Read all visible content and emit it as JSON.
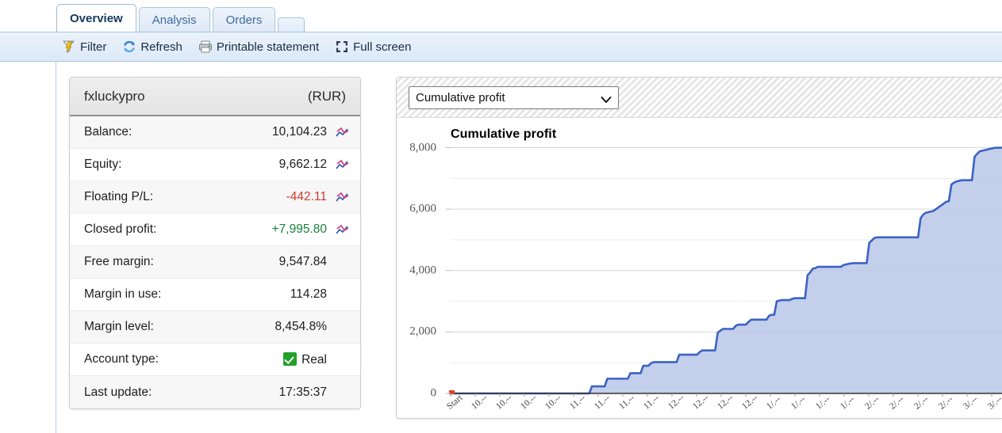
{
  "tabs": [
    {
      "label": "Overview",
      "active": true
    },
    {
      "label": "Analysis",
      "active": false
    },
    {
      "label": "Orders",
      "active": false
    },
    {
      "label": "",
      "active": false,
      "blank": true
    }
  ],
  "toolbar": {
    "items": [
      {
        "label": "Filter",
        "icon": "filter-icon"
      },
      {
        "label": "Refresh",
        "icon": "refresh-icon"
      },
      {
        "label": "Printable statement",
        "icon": "printer-icon"
      },
      {
        "label": "Full screen",
        "icon": "fullscreen-icon"
      }
    ]
  },
  "account": {
    "name": "fxluckypro",
    "currency": "(RUR)",
    "rows": [
      {
        "label": "Balance:",
        "value": "10,104.23",
        "tone": "",
        "spark": true
      },
      {
        "label": "Equity:",
        "value": "9,662.12",
        "tone": "",
        "spark": true
      },
      {
        "label": "Floating P/L:",
        "value": "-442.11",
        "tone": "neg",
        "spark": true
      },
      {
        "label": "Closed profit:",
        "value": "+7,995.80",
        "tone": "pos",
        "spark": true
      },
      {
        "label": "Free margin:",
        "value": "9,547.84",
        "tone": "",
        "spark": false
      },
      {
        "label": "Margin in use:",
        "value": "114.28",
        "tone": "",
        "spark": false
      },
      {
        "label": "Margin level:",
        "value": "8,454.8%",
        "tone": "",
        "spark": false
      },
      {
        "label": "Account type:",
        "value": "Real",
        "tone": "",
        "spark": false,
        "check": true
      },
      {
        "label": "Last update:",
        "value": "17:35:37",
        "tone": "",
        "spark": false
      }
    ]
  },
  "chart_panel": {
    "selected_option": "Cumulative profit",
    "options": [
      "Cumulative profit"
    ]
  },
  "colors": {
    "line": "#3b62c4",
    "fill": "#b8c7e8",
    "positive": "#188038",
    "negative": "#d13a2a",
    "accent": "#3c6ca0",
    "check_green": "#22a02a"
  },
  "chart_data": {
    "type": "area",
    "title": "Cumulative profit",
    "xlabel": "",
    "ylabel": "",
    "ylim": [
      0,
      8400
    ],
    "yticks": [
      0,
      2000,
      4000,
      6000,
      8000
    ],
    "ytick_labels": [
      "0",
      "2,000",
      "4,000",
      "6,000",
      "8,000"
    ],
    "minor_gridlines": [
      1000,
      3000,
      5000,
      7000
    ],
    "grid": true,
    "legend": false,
    "x_tick_labels": [
      "Start",
      "10.--",
      "10.--",
      "10.--",
      "10.--",
      "11.--",
      "11.--",
      "11.--",
      "11.--",
      "12.--",
      "12.--",
      "12.--",
      "12.--",
      "1/.--",
      "1/.--",
      "1/.--",
      "1/.--",
      "2/.--",
      "2/.--",
      "2/.--",
      "2/.--",
      "3/.--",
      "3/.--"
    ],
    "series": [
      {
        "name": "Cumulative profit",
        "values": [
          0,
          0,
          0,
          0,
          0,
          0,
          0,
          0,
          0,
          0,
          0,
          0,
          0,
          0,
          0,
          0,
          0,
          0,
          0,
          0,
          0,
          0,
          0,
          0,
          0,
          0,
          0,
          0,
          0,
          0,
          0,
          0,
          0,
          0,
          0,
          0,
          0,
          0,
          0,
          0,
          0,
          0,
          0,
          0,
          0,
          0,
          0,
          0,
          0,
          0,
          0,
          0,
          0,
          0,
          0,
          230,
          230,
          230,
          230,
          230,
          230,
          480,
          480,
          480,
          480,
          480,
          480,
          480,
          480,
          480,
          660,
          660,
          660,
          660,
          660,
          900,
          900,
          900,
          980,
          1020,
          1020,
          1020,
          1020,
          1020,
          1020,
          1020,
          1020,
          1020,
          1020,
          1260,
          1260,
          1260,
          1260,
          1260,
          1260,
          1260,
          1260,
          1350,
          1400,
          1400,
          1400,
          1400,
          1400,
          1400,
          1980,
          2040,
          2100,
          2100,
          2100,
          2100,
          2100,
          2200,
          2240,
          2240,
          2240,
          2240,
          2330,
          2400,
          2400,
          2400,
          2400,
          2400,
          2400,
          2400,
          2530,
          2560,
          2560,
          3000,
          3020,
          3040,
          3040,
          3040,
          3040,
          3080,
          3100,
          3100,
          3100,
          3100,
          3100,
          3850,
          3940,
          4060,
          4080,
          4120,
          4120,
          4120,
          4120,
          4120,
          4120,
          4120,
          4120,
          4120,
          4120,
          4180,
          4200,
          4220,
          4230,
          4240,
          4240,
          4240,
          4240,
          4240,
          4240,
          4900,
          4980,
          5060,
          5080,
          5080,
          5080,
          5080,
          5080,
          5080,
          5080,
          5080,
          5080,
          5080,
          5080,
          5080,
          5080,
          5080,
          5080,
          5080,
          5080,
          5700,
          5820,
          5880,
          5900,
          5920,
          5940,
          6000,
          6060,
          6120,
          6180,
          6240,
          6260,
          6800,
          6860,
          6900,
          6920,
          6940,
          6940,
          6940,
          6940,
          6940,
          7700,
          7800,
          7880,
          7900,
          7920,
          7940,
          7960,
          7980,
          7995,
          7995,
          8000,
          8000
        ]
      }
    ]
  }
}
